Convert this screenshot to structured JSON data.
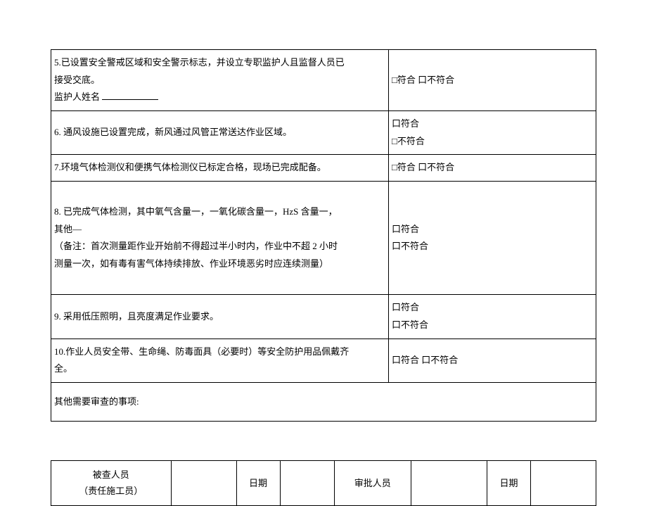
{
  "rows": {
    "r5": {
      "line1": "5.已设置安全警戒区域和安全警示标志，并设立专职监护人且监督人员已",
      "line2": "接受交底。",
      "line3_prefix": "监护人姓名",
      "status": "□符合 口不符合"
    },
    "r6": {
      "desc": "6. 通风设施已设置完成，新风通过风管正常送达作业区域。",
      "status1": "口符合",
      "status2": "□不符合"
    },
    "r7": {
      "desc": "7.环境气体检测仪和便携气体检测仪已标定合格，现场已完成配备。",
      "status": "□符合 口不符合"
    },
    "r8": {
      "line1": "8. 已完成气体检测，其中氧气含量一，一氧化碳含量一，HzS 含量一，",
      "line2": "其他—",
      "line3": "（备注：首次测量距作业开始前不得超过半小时内，作业中不超 2 小时",
      "line4": "测量一次，如有毒有害气体持续排放、作业环境恶劣时应连续测量）",
      "status1": "口符合",
      "status2": "口不符合"
    },
    "r9": {
      "desc": "9. 采用低压照明，且亮度满足作业要求。",
      "status1": "口符合",
      "status2": "口不符合"
    },
    "r10": {
      "line1": "10.作业人员安全带、生命绳、防毒面具（必要时）等安全防护用品佩戴齐",
      "line2": "全。",
      "status": "口符合 口不符合"
    },
    "other": {
      "label": "其他需要审查的事项:"
    }
  },
  "sig": {
    "checked_label1": "被查人员",
    "checked_label2": "（责任施工员）",
    "date_label": "日期",
    "approver_label": "审批人员"
  }
}
